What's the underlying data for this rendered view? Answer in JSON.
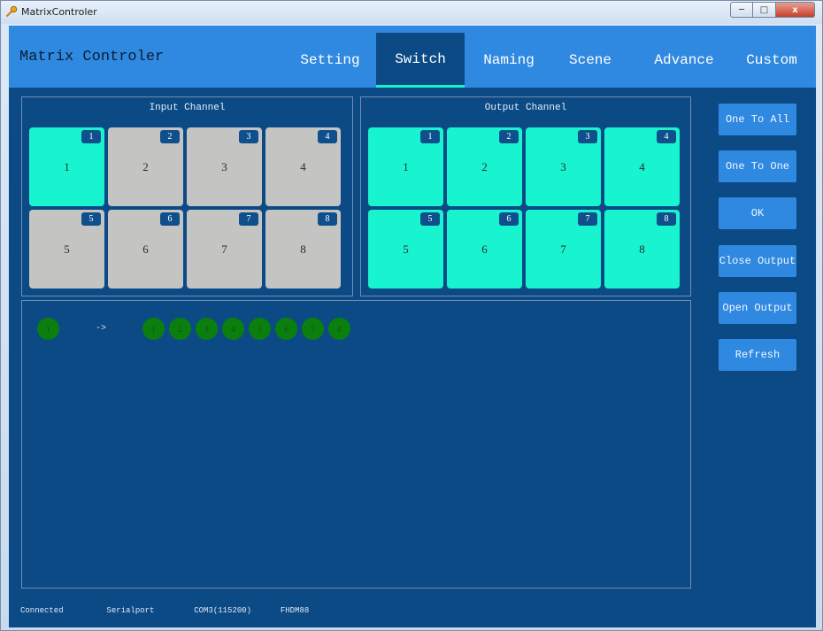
{
  "window": {
    "title": "MatrixControler",
    "minimize_glyph": "─",
    "maximize_glyph": "□",
    "close_glyph": "x"
  },
  "app": {
    "title": "Matrix Controler"
  },
  "tabs": [
    {
      "label": "Setting",
      "active": false
    },
    {
      "label": "Switch",
      "active": true
    },
    {
      "label": "Naming",
      "active": false
    },
    {
      "label": "Scene",
      "active": false
    },
    {
      "label": "Advance",
      "active": false
    },
    {
      "label": "Custom",
      "active": false
    }
  ],
  "input_panel": {
    "title": "Input Channel",
    "channels": [
      {
        "badge": "1",
        "label": "1",
        "selected": true
      },
      {
        "badge": "2",
        "label": "2",
        "selected": false
      },
      {
        "badge": "3",
        "label": "3",
        "selected": false
      },
      {
        "badge": "4",
        "label": "4",
        "selected": false
      },
      {
        "badge": "5",
        "label": "5",
        "selected": false
      },
      {
        "badge": "6",
        "label": "6",
        "selected": false
      },
      {
        "badge": "7",
        "label": "7",
        "selected": false
      },
      {
        "badge": "8",
        "label": "8",
        "selected": false
      }
    ]
  },
  "output_panel": {
    "title": "Output Channel",
    "channels": [
      {
        "badge": "1",
        "label": "1",
        "selected": true
      },
      {
        "badge": "2",
        "label": "2",
        "selected": true
      },
      {
        "badge": "3",
        "label": "3",
        "selected": true
      },
      {
        "badge": "4",
        "label": "4",
        "selected": true
      },
      {
        "badge": "5",
        "label": "5",
        "selected": true
      },
      {
        "badge": "6",
        "label": "6",
        "selected": true
      },
      {
        "badge": "7",
        "label": "7",
        "selected": true
      },
      {
        "badge": "8",
        "label": "8",
        "selected": true
      }
    ]
  },
  "actions": {
    "one_to_all": "One To All",
    "one_to_one": "One To One",
    "ok": "OK",
    "close_output": "Close Output",
    "open_output": "Open Output",
    "refresh": "Refresh"
  },
  "routing": {
    "input": "1",
    "arrow": "->",
    "outputs": [
      "1",
      "2",
      "3",
      "4",
      "5",
      "6",
      "7",
      "8"
    ]
  },
  "status": {
    "connection": "Connected",
    "port_type": "Serialport",
    "port": "COM3(115200)",
    "device": "FHDM88"
  },
  "colors": {
    "background": "#0c4a86",
    "header": "#3089e0",
    "tile_active": "#18f4cf",
    "tile_inactive": "#c4c4c2",
    "route_dot": "#0a7f0d"
  }
}
